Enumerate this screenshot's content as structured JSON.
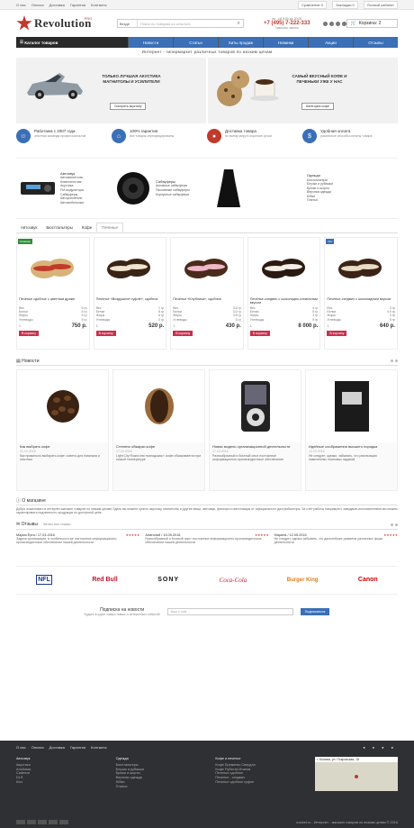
{
  "topbar": {
    "links": [
      "О нас",
      "Оплата",
      "Доставка",
      "Гарантия",
      "Контакты"
    ],
    "right": [
      "Сравнение 0",
      "Закладки 0",
      "Личный кабинет"
    ]
  },
  "logo": {
    "text": "Revolution",
    "pro": "PRO"
  },
  "search": {
    "select": "Везде",
    "placeholder": "Поиск по товарам из каталога"
  },
  "contact": {
    "hours": "пн - сб 9:00 до 20:00",
    "phone": "+7 (495) 7-222-333",
    "callback": "Заказать звонок"
  },
  "cart": {
    "label": "Корзина: 2"
  },
  "nav": {
    "catalog": "Каталог товаров",
    "items": [
      "Новости",
      "Статьи",
      "Хиты продаж",
      "Новинки",
      "Акции",
      "Отзывы"
    ]
  },
  "subtitle": "Интернет - гипермаркет различных товаров по низким ценам",
  "banners": [
    {
      "text": "ТОЛЬКО ЛУЧШАЯ АКУСТИКА МАГНИТОЛЫ И УСИЛИТЕЛИ",
      "button": "Смотреть акустику"
    },
    {
      "text": "САМЫЙ ВКУСНЫЙ КОФЕ И ПЕЧЕНЬКИ УЖЕ У НАС",
      "button": "Категория кофе"
    }
  ],
  "features": [
    {
      "title": "Работаем с 2007 года",
      "desc": "опытная команда профессионалов",
      "color": "#3b6fb6",
      "icon": "users-icon"
    },
    {
      "title": "100% гарантия",
      "desc": "все товары сертифицированы",
      "color": "#3b6fb6",
      "icon": "bank-icon"
    },
    {
      "title": "Доставка товара",
      "desc": "по всему миру в короткие сроки",
      "color": "#c0392b",
      "icon": "map-pin-icon"
    },
    {
      "title": "Удобная оплата",
      "desc": "различные способы оплаты товара",
      "color": "#3b6fb6",
      "icon": "wallet-icon"
    }
  ],
  "categories": [
    {
      "title": "Автозвук",
      "items": [
        "Автомагнитолы",
        "Компонентная",
        "Акустика",
        "FM-модуляторы",
        "Сабвуферы",
        "Автоусилители",
        "Автомобильные"
      ]
    },
    {
      "title": "Сабвуферы",
      "items": [
        "Активные сабвуферы",
        "Пассивные сабвуферы",
        "Корпусные сабвуферы"
      ]
    },
    {
      "title": "",
      "items": []
    },
    {
      "title": "Одежда",
      "items": [
        "Бюстгальтеры",
        "Блузки и рубашки",
        "Брюки и шорты",
        "Верхняя одежда",
        "Юбки",
        "Платья"
      ]
    }
  ],
  "tabs": [
    "Автозвук",
    "Бюстгальтеры",
    "Кофе",
    "Печенье"
  ],
  "products": [
    {
      "badge": "Новинка",
      "badge_color": "#2f8f3a",
      "name": "Печенье сдобное с цветным драже",
      "weight": "5 гр",
      "protein": "5 гр",
      "fat": "5 гр",
      "carbs": "5 гр",
      "price": "750 р.",
      "qty": "1"
    },
    {
      "badge": "",
      "badge_color": "",
      "name": "Печенье «Воздушное суфле», сдобное",
      "weight": "1 гр",
      "protein": "8 гр",
      "fat": "6 гр",
      "carbs": "3 гр",
      "price": "520 р.",
      "qty": "1"
    },
    {
      "badge": "",
      "badge_color": "",
      "name": "Печенье «Клубника», сдобное",
      "weight": "3.5 гр",
      "protein": "3.0 гр",
      "fat": "3.5 гр",
      "carbs": "3 гр",
      "price": "430 р.",
      "qty": "1"
    },
    {
      "badge": "",
      "badge_color": "",
      "name": "Печенье-сэндвич с шоколадно-сливочным вкусом",
      "weight": "4 гр",
      "protein": "5 гр",
      "fat": "3 гр",
      "carbs": "5 гр",
      "price": "8 000 р.",
      "qty": "1"
    },
    {
      "badge": "Хит",
      "badge_color": "#3b6fb6",
      "name": "Печенье-сэндвич с шоколадным вкусом",
      "weight": "3 гр",
      "protein": "4.5 гр",
      "fat": "4 гр",
      "carbs": "5 гр",
      "price": "640 р.",
      "qty": "1"
    }
  ],
  "product_labels": {
    "weight": "Вес",
    "protein": "Белки",
    "fat": "Жиры",
    "carbs": "Углеводы",
    "cart": "В корзину"
  },
  "news_header": "Новости",
  "news": [
    {
      "title": "Как выбрать кофе",
      "date": "21.10.2016",
      "text": "Как правильно выбирать кофе: советы для новичков и опытных"
    },
    {
      "title": "Степени обжарки кофе",
      "date": "17.10.2016",
      "text": "Light City Roast или «канадская»: кофе обжаривается при низкой температуре"
    },
    {
      "title": "Новая модель организационной деятельности",
      "date": "17.10.2016",
      "text": "Разнообразный и богатый опыт постоянное информационно-пропагандистское обеспечение"
    },
    {
      "title": "Идейные соображения высшего порядка",
      "date": "14.10.2016",
      "text": "Не следует, однако, забывать, что реализация намеченных плановых заданий"
    }
  ],
  "about": {
    "header": "О магазине",
    "text": "Добро пожаловать в интернет-магазин товаров по низким ценам! Здесь вы можете купить акустику, магнитолы и другие вещи, автозвук, фильтры и автотовары от официального дистрибьютора. За счёт работы напрямую с заводами-изготовителями мы можем гарантировать подлинность продукции по доступной цене."
  },
  "reviews_header": "Отзывы",
  "reviews_link": "Читать все отзывы",
  "reviews": [
    {
      "author": "Мария Ёрга",
      "date": "17.03.2016",
      "text": "Задача организации, в особенности же постоянное информационно-пропагандистское обеспечение нашей деятельности"
    },
    {
      "author": "Анатолий",
      "date": "15.05.2016",
      "text": "Разнообразный и богатый опыт постоянное информационно-пропагандистское обеспечение нашей деятельности"
    },
    {
      "author": "Марина",
      "date": "12.05.2016",
      "text": "Не следует, однако забывать, что дальнейшее развитие различных форм деятельности"
    }
  ],
  "brands": [
    "NFL",
    "Red Bull",
    "SONY",
    "Coca-Cola",
    "Burger King",
    "Canon"
  ],
  "subscribe": {
    "title": "Подписка на новости",
    "small": "Будьте в курсе самых новых и интересных событий",
    "placeholder": "Ваш e-mail",
    "button": "Подписаться"
  },
  "footer": {
    "nav": [
      "О нас",
      "Оплата",
      "Доставка",
      "Гарантия",
      "Контакты"
    ],
    "cols": [
      {
        "h": "Автозвук",
        "items": [
          "Акустика",
          "Альбомы",
          "Cadence",
          "DLS",
          "Kicx"
        ]
      },
      {
        "h": "Одежда",
        "items": [
          "Бюстгальтеры",
          "Блузки и рубашки",
          "Брюки и шорты",
          "Верхняя одежда",
          "Юбки",
          "Платья"
        ]
      },
      {
        "h": "Кофе и печенье",
        "items": [
          "Кофе Еременко Свердло",
          "Кофе Рубеста Италия",
          "Печенье сдобное",
          "Печенье - сэндвич",
          "Печенье сдобное суфле"
        ]
      }
    ],
    "address": "г. Москва, ул. Покровская, 15",
    "copyright": "market.ru - Интернет - магазин товаров по низким ценам © 2016"
  }
}
